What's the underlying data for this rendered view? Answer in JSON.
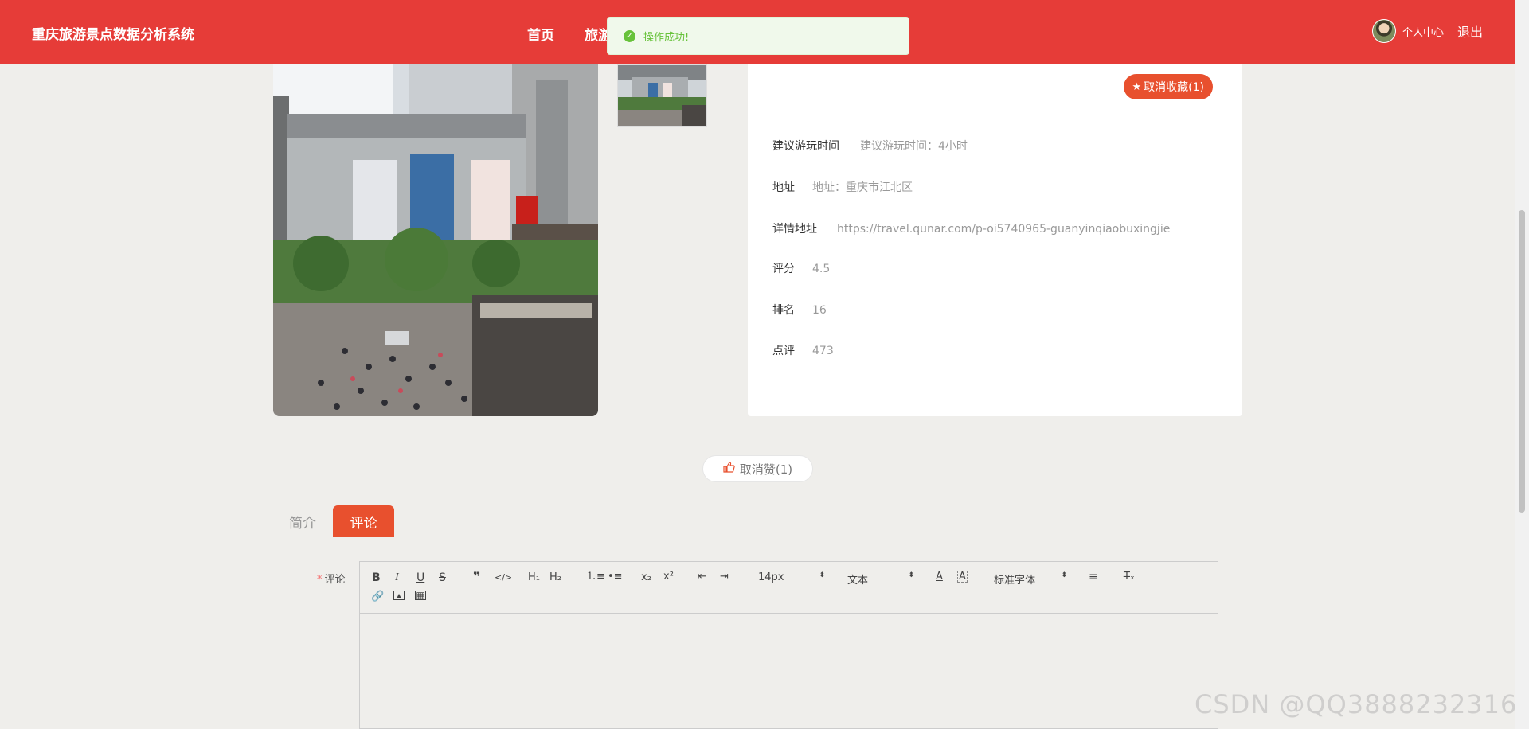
{
  "header": {
    "brand": "重庆旅游景点数据分析系统",
    "nav": [
      "首页",
      "旅游"
    ],
    "user_center": "个人中心",
    "logout": "退出"
  },
  "toast": {
    "message": "操作成功!"
  },
  "detail": {
    "favorite_label": "取消收藏(1)",
    "rows": [
      {
        "label": "建议游玩时间",
        "value": "建议游玩时间：4小时"
      },
      {
        "label": "地址",
        "value": "地址：重庆市江北区"
      },
      {
        "label": "详情地址",
        "value": "https://travel.qunar.com/p-oi5740965-guanyinqiaobuxingjie"
      },
      {
        "label": "评分",
        "value": "4.5"
      },
      {
        "label": "排名",
        "value": "16"
      },
      {
        "label": "点评",
        "value": "473"
      }
    ]
  },
  "like_label": "取消赞(1)",
  "tabs": {
    "intro": "简介",
    "comment": "评论"
  },
  "form": {
    "required_mark": "*",
    "comment_label": "评论",
    "toolbar": {
      "font_size": "14px",
      "block_type": "文本",
      "font_family": "标准字体"
    }
  },
  "watermark": "CSDN @QQ3888232316",
  "colors": {
    "header": "#e63c38",
    "accent": "#e8502e",
    "success": "#67c23a"
  }
}
